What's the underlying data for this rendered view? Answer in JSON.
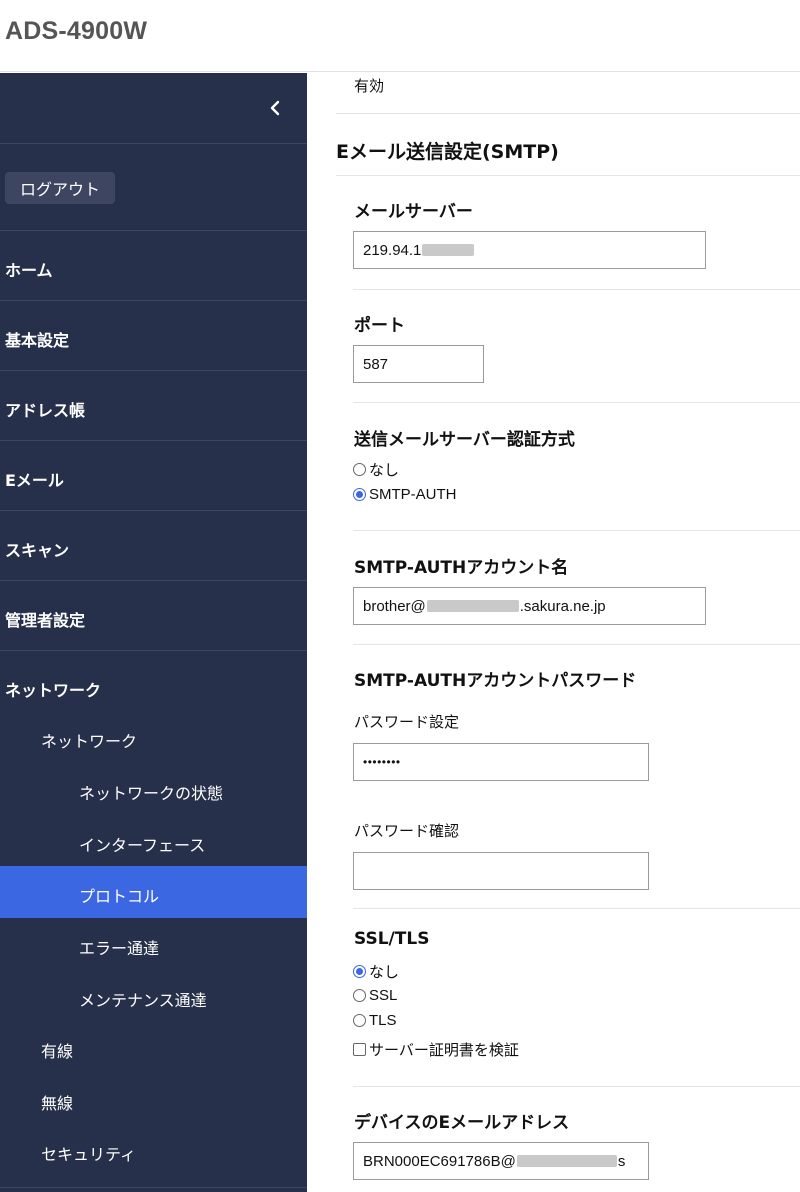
{
  "header": {
    "title": "ADS-4900W"
  },
  "sidebar": {
    "logout_label": "ログアウト",
    "items": [
      {
        "label": "ホーム"
      },
      {
        "label": "基本設定"
      },
      {
        "label": "アドレス帳"
      },
      {
        "label": "Eメール"
      },
      {
        "label": "スキャン"
      },
      {
        "label": "管理者設定"
      },
      {
        "label": "ネットワーク"
      }
    ],
    "network_sub": {
      "network_label": "ネットワーク",
      "network_children": [
        "ネットワークの状態",
        "インターフェース",
        "プロトコル",
        "エラー通達",
        "メンテナンス通達"
      ],
      "active": "プロトコル",
      "others": [
        "有線",
        "無線",
        "セキュリティ"
      ]
    }
  },
  "main": {
    "prev_value": "有効",
    "section_title": "Eメール送信設定(SMTP)",
    "mail_server": {
      "label": "メールサーバー",
      "value": "219.94.1"
    },
    "port": {
      "label": "ポート",
      "value": "587"
    },
    "auth": {
      "label": "送信メールサーバー認証方式",
      "options": [
        "なし",
        "SMTP-AUTH"
      ],
      "selected": "SMTP-AUTH"
    },
    "account": {
      "label": "SMTP-AUTHアカウント名",
      "value_prefix": "brother@",
      "value_suffix": ".sakura.ne.jp"
    },
    "password": {
      "label": "SMTP-AUTHアカウントパスワード",
      "set_label": "パスワード設定",
      "set_value": "••••••••",
      "confirm_label": "パスワード確認",
      "confirm_value": ""
    },
    "ssl": {
      "label": "SSL/TLS",
      "options": [
        "なし",
        "SSL",
        "TLS"
      ],
      "selected": "なし",
      "verify_label": "サーバー証明書を検証"
    },
    "device_email": {
      "label": "デバイスのEメールアドレス",
      "value_prefix": "BRN000EC691786B@",
      "value_suffix": "s"
    }
  },
  "colors": {
    "sidebar_bg": "#27304a",
    "active_bg": "#3c67e3",
    "header_title": "#555555"
  }
}
